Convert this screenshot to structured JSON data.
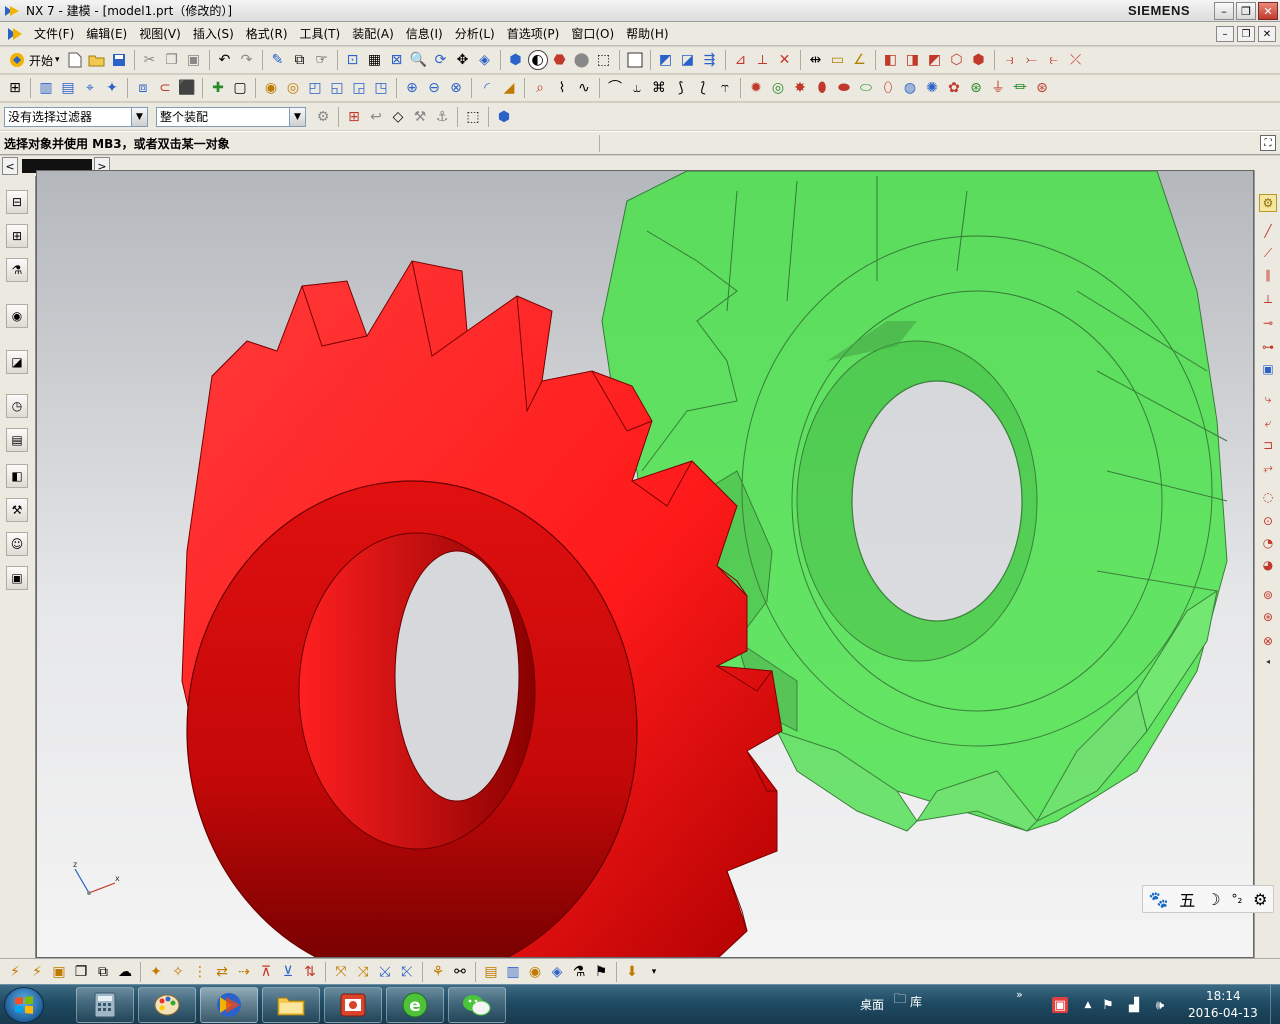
{
  "window": {
    "title": "NX 7 - 建模 - [model1.prt（修改的）]",
    "brand": "SIEMENS",
    "minimize": "–",
    "restore": "❐",
    "close": "✕"
  },
  "menu": {
    "items": [
      "文件(F)",
      "编辑(E)",
      "视图(V)",
      "插入(S)",
      "格式(R)",
      "工具(T)",
      "装配(A)",
      "信息(I)",
      "分析(L)",
      "首选项(P)",
      "窗口(O)",
      "帮助(H)"
    ],
    "mdi": [
      "–",
      "❐",
      "✕"
    ]
  },
  "toolbar": {
    "start_label": "开始",
    "start_arrow": "▾"
  },
  "selection_bar": {
    "filter_value": "没有选择过滤器",
    "scope_value": "整个装配",
    "arrow": "▼"
  },
  "cue_line": {
    "text": "选择对象并使用 MB3，或者双击某一对象"
  },
  "tabs": {
    "prev": "<",
    "next": ">"
  },
  "ime_bar": {
    "items": [
      "🐾",
      "五",
      "☽",
      "°₂",
      "⚙"
    ]
  },
  "taskbar": {
    "desktop_label": "桌面",
    "library_label": "库",
    "expand": "»",
    "time": "18:14",
    "date": "2016-04-13"
  },
  "colors": {
    "red_gear": "#ff1a1a",
    "green_gear": "#4ce34c",
    "accent_blue": "#1f4b63"
  }
}
